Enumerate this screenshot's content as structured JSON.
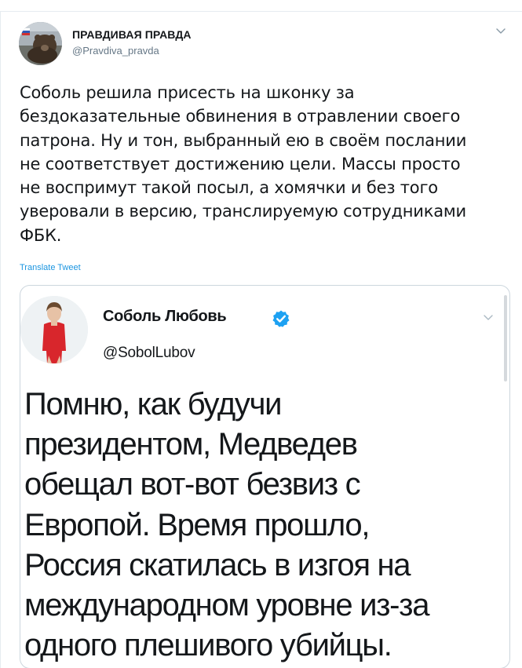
{
  "tweet": {
    "author_name": "ПРАВДИВАЯ ПРАВДА",
    "author_handle": "@Pravdiva_pravda",
    "text_lines": [
      "Соболь решила присесть на шконку за",
      "бездоказательные обвинения в отравлении своего",
      "патрона. Ну и тон, выбранный ею  в своём послании",
      "не соответствует достижению  цели. Массы просто",
      "не воспримут такой посыл, а хомячки и без того",
      "уверовали в версию, транслируемую сотрудниками",
      "ФБК."
    ],
    "translate_label": "Translate Tweet",
    "menu_icon": "chevron-down-icon"
  },
  "quoted": {
    "author_name": "Соболь Любовь",
    "author_handle": "@SobolLubov",
    "verified_icon": "verified-badge-icon",
    "text_lines": [
      "Помню, как будучи",
      "президентом, Медведев",
      "обещал вот-вот безвиз с",
      "Европой. Время прошло,",
      "Россия скатилась в изгоя на",
      "международном уровне из-за",
      "одного плешивого убийцы."
    ]
  },
  "colors": {
    "link": "#1b95e0",
    "verified": "#1da1f2",
    "border": "#ccd6dd",
    "secondary_text": "#657786"
  }
}
